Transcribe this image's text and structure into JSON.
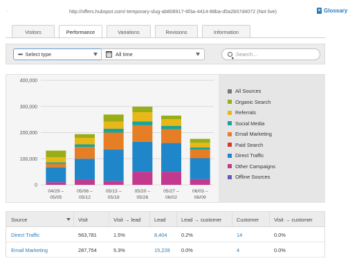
{
  "header": {
    "dot": ".",
    "url_text": "http://offers.hubspot.com/-temporary-slug-ab808917-6f3a-4414-88ba-d5a2b57d4072 (Not live)",
    "glossary_label": "Glossary"
  },
  "tabs": [
    {
      "label": "Visitors",
      "active": false
    },
    {
      "label": "Performance",
      "active": true
    },
    {
      "label": "Variations",
      "active": false
    },
    {
      "label": "Revisions",
      "active": false
    },
    {
      "label": "Information",
      "active": false
    }
  ],
  "filters": {
    "type_value": "Select type",
    "type_dots": "•••",
    "time_value": "All time",
    "search_placeholder": "Search..."
  },
  "chart_data": {
    "type": "bar",
    "stacked": true,
    "categories": [
      "04/29 - 05/05",
      "05/06 - 05/12",
      "05/13 - 05/19",
      "05/20 - 05/26",
      "05/27 - 06/02",
      "06/03 - 06/09"
    ],
    "y_ticks": [
      "400,000",
      "300,000",
      "200,000",
      "100,000",
      "0"
    ],
    "ylim": [
      0,
      400000
    ],
    "grid": true,
    "legend_position": "right",
    "series": [
      {
        "name": "Other Campaigns",
        "color": "#c2398e",
        "values": [
          10000,
          20000,
          15000,
          50000,
          50000,
          22000
        ]
      },
      {
        "name": "Direct Traffic",
        "color": "#1f87c9",
        "values": [
          57000,
          80000,
          120000,
          115000,
          110000,
          80000
        ]
      },
      {
        "name": "Email Marketing",
        "color": "#e67e25",
        "values": [
          13000,
          45000,
          65000,
          63000,
          53000,
          33000
        ]
      },
      {
        "name": "Social Media",
        "color": "#1aa39b",
        "values": [
          6000,
          10000,
          15000,
          15000,
          13000,
          8000
        ]
      },
      {
        "name": "Referrals",
        "color": "#e8b818",
        "values": [
          20000,
          25000,
          27000,
          35000,
          25000,
          18000
        ]
      },
      {
        "name": "Organic Search",
        "color": "#98ad16",
        "values": [
          25000,
          14000,
          27000,
          21000,
          14000,
          15000
        ]
      }
    ]
  },
  "legend": [
    {
      "label": "All Sources",
      "color": "#777777"
    },
    {
      "label": "Organic Search",
      "color": "#98ad16"
    },
    {
      "label": "Referrals",
      "color": "#e8b818"
    },
    {
      "label": "Social Media",
      "color": "#1aa39b"
    },
    {
      "label": "Email Marketing",
      "color": "#e67e25"
    },
    {
      "label": "Paid Search",
      "color": "#d23a2a"
    },
    {
      "label": "Direct Traffic",
      "color": "#1f87c9"
    },
    {
      "label": "Other Campaigns",
      "color": "#c2398e"
    },
    {
      "label": "Offline Sources",
      "color": "#6e55b8"
    }
  ],
  "table": {
    "headers": [
      "Source",
      "Visit",
      "Visit → lead",
      "Lead",
      "Lead → customer",
      "Customer",
      "Visit → customer"
    ],
    "rows": [
      [
        "Direct Traffic",
        "563,781",
        "1.5%",
        "8,404",
        "0.2%",
        "14",
        "0.0%"
      ],
      [
        "Email Marketing",
        "287,754",
        "5.3%",
        "15,228",
        "0.0%",
        "4",
        "0.0%"
      ]
    ]
  }
}
